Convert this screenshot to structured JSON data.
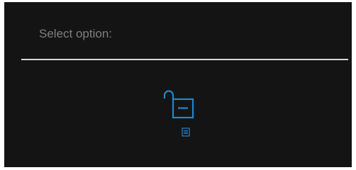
{
  "panel": {
    "title": "Select option:"
  },
  "options": [
    {
      "id": "menu-lock",
      "icon": "unlocked-padlock-icon",
      "sub_icon": "menu-list-icon"
    }
  ],
  "colors": {
    "background": "#141414",
    "title_text": "#7f7f7f",
    "divider": "#d8d8d8",
    "accent": "#1f86d1"
  }
}
